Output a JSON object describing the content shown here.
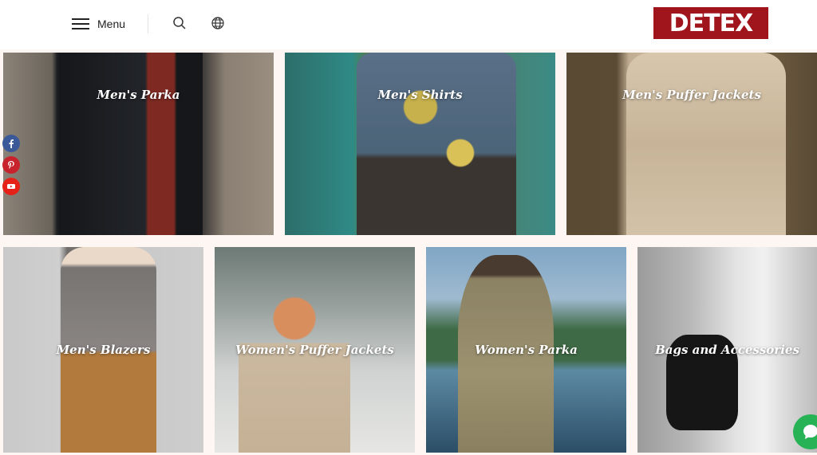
{
  "header": {
    "menu_label": "Menu",
    "logo_text": "DETEX",
    "logo_bg": "#a0141b",
    "icons": [
      "menu-icon",
      "search-icon",
      "globe-icon"
    ]
  },
  "tiles": [
    {
      "title": "Men's Parka"
    },
    {
      "title": "Men's Shirts"
    },
    {
      "title": "Men's Puffer Jackets"
    },
    {
      "title": "Men's Blazers"
    },
    {
      "title": "Women's Puffer Jackets"
    },
    {
      "title": "Women's Parka"
    },
    {
      "title": "Bags and Accessories"
    }
  ],
  "social": [
    {
      "icon": "facebook-icon",
      "color": "#3b5998"
    },
    {
      "icon": "pinterest-icon",
      "color": "#c8232c"
    },
    {
      "icon": "youtube-icon",
      "color": "#e62117"
    }
  ],
  "chat": {
    "icon": "chat-icon",
    "color": "#27b255"
  }
}
